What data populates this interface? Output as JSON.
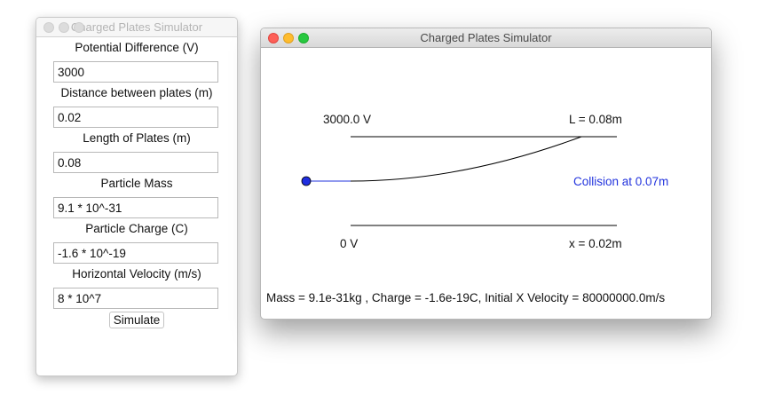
{
  "panel": {
    "title": "Charged Plates Simulator",
    "fields": [
      {
        "label": "Potential Difference (V)",
        "value": "3000"
      },
      {
        "label": "Distance between plates (m)",
        "value": "0.02"
      },
      {
        "label": "Length of Plates (m)",
        "value": "0.08"
      },
      {
        "label": "Particle Mass",
        "value": "9.1 * 10^-31"
      },
      {
        "label": "Particle Charge (C)",
        "value": "-1.6 * 10^-19"
      },
      {
        "label": "Horizontal Velocity (m/s)",
        "value": "8 * 10^7"
      }
    ],
    "simulate_label": "Simulate"
  },
  "sim": {
    "title": "Charged Plates Simulator",
    "top_voltage": "3000.0 V",
    "bottom_voltage": "0 V",
    "length_label": "L = 0.08m",
    "distance_label": "x = 0.02m",
    "collision_label": "Collision at 0.07m",
    "info": "Mass = 9.1e-31kg , Charge = -1.6e-19C, Initial X Velocity = 80000000.0m/s",
    "colors": {
      "particle": "#1f2ee0",
      "path_entry": "#2233dd",
      "trajectory": "#000000",
      "collision_text": "#2233dd"
    }
  }
}
